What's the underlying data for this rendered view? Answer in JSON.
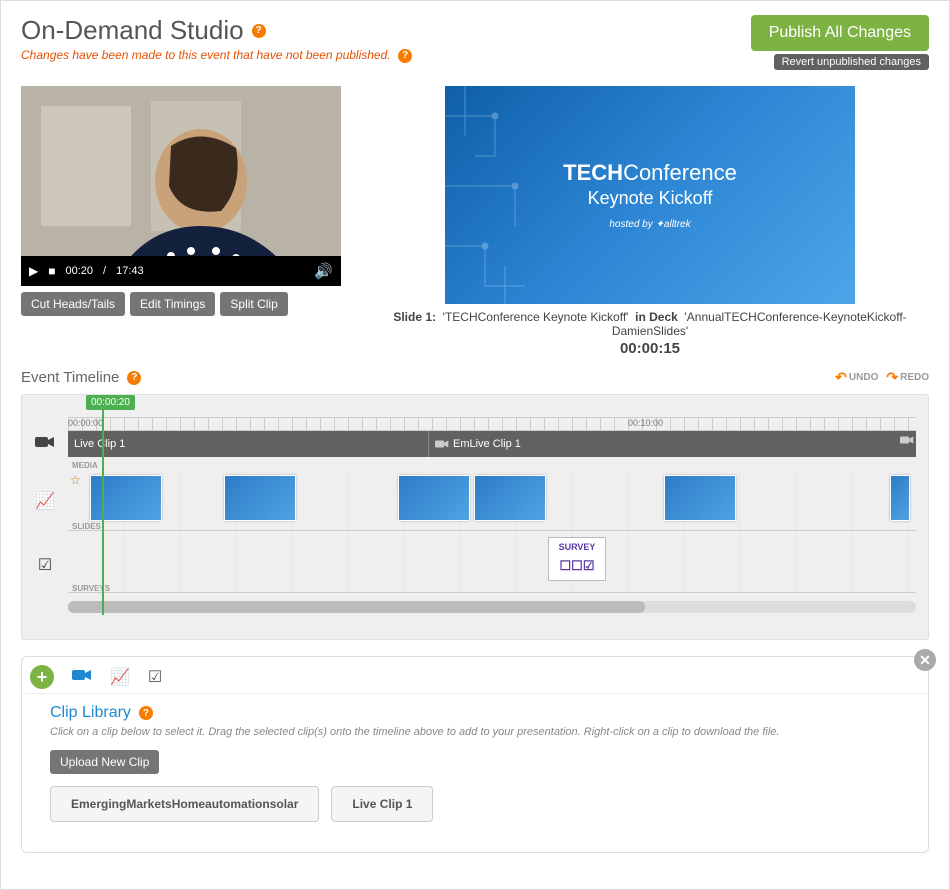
{
  "header": {
    "title": "On-Demand Studio",
    "warning": "Changes have been made to this event that have not been published.",
    "publish_label": "Publish All Changes",
    "revert_label": "Revert unpublished changes"
  },
  "video": {
    "current_time": "00:20",
    "duration": "17:43",
    "buttons": {
      "cut": "Cut Heads/Tails",
      "edit_timings": "Edit Timings",
      "split": "Split Clip"
    }
  },
  "slide_preview": {
    "brand_bold": "TECH",
    "brand_rest": "Conference",
    "subtitle": "Keynote Kickoff",
    "hosted_prefix": "hosted by",
    "hosted_brand": "alltrek",
    "caption_label": "Slide 1:",
    "caption_name": "'TECHConference Keynote Kickoff'",
    "caption_in": "in Deck",
    "caption_deck": "'AnnualTECHConference-KeynoteKickoff-DamienSlides'",
    "timestamp": "00:00:15"
  },
  "timeline": {
    "title": "Event Timeline",
    "undo_label": "UNDO",
    "redo_label": "REDO",
    "playhead_time": "00:00:20",
    "ruler": {
      "t0": "00:00:00",
      "t10": "00:10:00"
    },
    "video_track": {
      "label": "MEDIA",
      "clips": [
        "Live Clip 1",
        "EmLive Clip 1"
      ]
    },
    "slides_track": {
      "label": "SLIDES"
    },
    "surveys_track": {
      "label": "SURVEYS",
      "item_label": "SURVEY"
    }
  },
  "library": {
    "title": "Clip Library",
    "hint": "Click on a clip below to select it. Drag the selected clip(s) onto the timeline above to add to your presentation. Right-click on a clip to download the file.",
    "upload_label": "Upload New Clip",
    "clips": [
      "EmergingMarketsHomeautomationsolar",
      "Live Clip 1"
    ]
  }
}
